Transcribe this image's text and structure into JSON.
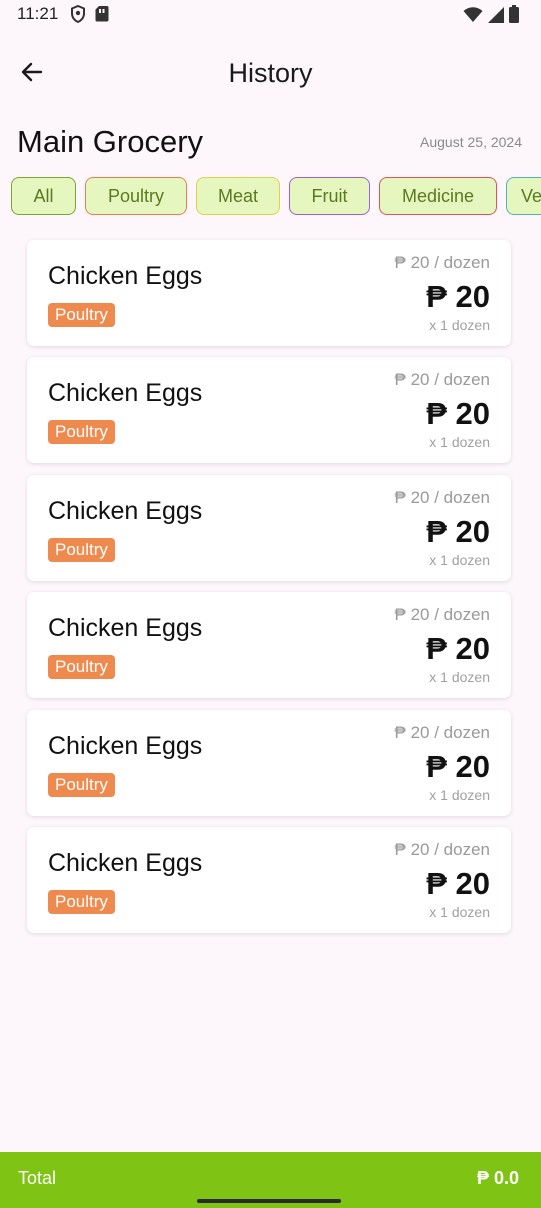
{
  "status_bar": {
    "time": "11:21",
    "left_icons": [
      "shield-icon",
      "sim-card-icon"
    ],
    "right_icons": [
      "wifi-icon",
      "signal-icon",
      "battery-icon"
    ]
  },
  "app_bar": {
    "title": "History",
    "back_icon": "arrow-left-icon"
  },
  "list": {
    "title": "Main Grocery",
    "date": "August 25, 2024"
  },
  "categories": [
    {
      "label": "All",
      "border": "#77a632"
    },
    {
      "label": "Poultry",
      "border": "#e4804f"
    },
    {
      "label": "Meat",
      "border": "#e0d04a"
    },
    {
      "label": "Fruit",
      "border": "#9a62d2"
    },
    {
      "label": "Medicine",
      "border": "#d8555a"
    },
    {
      "label": "Ve",
      "border": "#4fb0c8"
    }
  ],
  "items": [
    {
      "name": "Chicken Eggs",
      "category": "Poultry",
      "unit_price": "₱ 20 / dozen",
      "total": "₱ 20",
      "quantity": "x 1 dozen"
    },
    {
      "name": "Chicken Eggs",
      "category": "Poultry",
      "unit_price": "₱ 20 / dozen",
      "total": "₱ 20",
      "quantity": "x 1 dozen"
    },
    {
      "name": "Chicken Eggs",
      "category": "Poultry",
      "unit_price": "₱ 20 / dozen",
      "total": "₱ 20",
      "quantity": "x 1 dozen"
    },
    {
      "name": "Chicken Eggs",
      "category": "Poultry",
      "unit_price": "₱ 20 / dozen",
      "total": "₱ 20",
      "quantity": "x 1 dozen"
    },
    {
      "name": "Chicken Eggs",
      "category": "Poultry",
      "unit_price": "₱ 20 / dozen",
      "total": "₱ 20",
      "quantity": "x 1 dozen"
    },
    {
      "name": "Chicken Eggs",
      "category": "Poultry",
      "unit_price": "₱ 20 / dozen",
      "total": "₱ 20",
      "quantity": "x 1 dozen"
    }
  ],
  "footer": {
    "total_label": "Total",
    "total_value": "₱ 0.0"
  },
  "colors": {
    "accent_green": "#7fc414",
    "badge_orange": "#ef8a4f",
    "chip_fill": "#e6f6bf",
    "background": "#fdf7fb"
  }
}
